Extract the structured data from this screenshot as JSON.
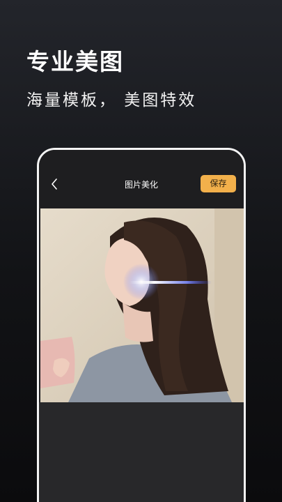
{
  "promo": {
    "title": "专业美图",
    "subtitle": "海量模板， 美图特效"
  },
  "app": {
    "title": "图片美化",
    "save_label": "保存",
    "accent_color": "#f2b04b"
  },
  "icons": {
    "back": "chevron-left-icon"
  },
  "photo": {
    "content": "portrait photo with light streak effect"
  }
}
